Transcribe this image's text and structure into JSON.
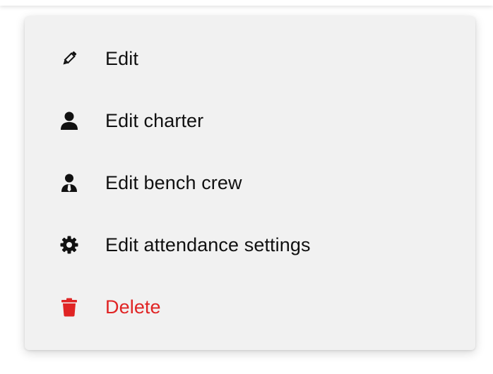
{
  "menu": {
    "items": [
      {
        "label": "Edit",
        "icon": "pencil-icon"
      },
      {
        "label": "Edit charter",
        "icon": "user-icon"
      },
      {
        "label": "Edit bench crew",
        "icon": "user-tie-icon"
      },
      {
        "label": "Edit attendance settings",
        "icon": "gear-icon"
      },
      {
        "label": "Delete",
        "icon": "trash-icon",
        "color": "#e02424"
      }
    ]
  }
}
